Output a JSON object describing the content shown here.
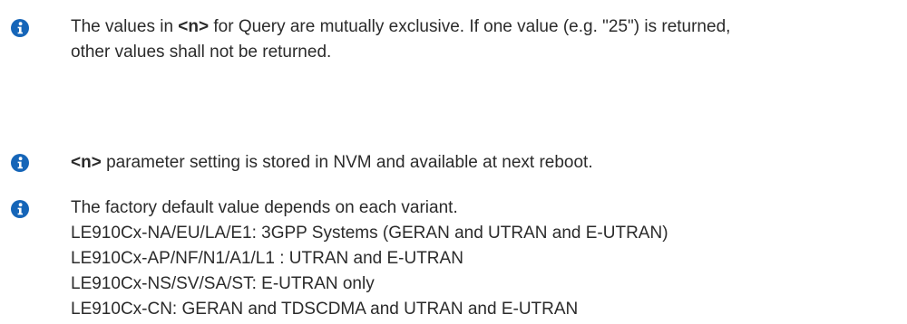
{
  "notes": [
    {
      "icon": "info-icon",
      "lines": [
        {
          "prefix": "The values in ",
          "bold": "<n>",
          "suffix": " for Query are mutually exclusive. If one value (e.g. \"25\") is returned,"
        },
        {
          "text": "other values shall not be returned."
        }
      ]
    },
    {
      "icon": "info-icon",
      "lines": [
        {
          "bold": "<n>",
          "suffix": " parameter setting is stored in NVM and available at next reboot."
        }
      ]
    },
    {
      "icon": "info-icon",
      "lines": [
        {
          "text": "The factory default value depends on each variant."
        },
        {
          "text": "LE910Cx-NA/EU/LA/E1: 3GPP Systems (GERAN and UTRAN and E-UTRAN)"
        },
        {
          "text": "LE910Cx-AP/NF/N1/A1/L1 : UTRAN and E-UTRAN"
        },
        {
          "text": "LE910Cx-NS/SV/SA/ST: E-UTRAN only"
        },
        {
          "text": "LE910Cx-CN: GERAN and TDSCDMA and UTRAN and E-UTRAN"
        }
      ]
    }
  ],
  "colors": {
    "icon_fill": "#1565b8",
    "text": "#2b2b2b"
  }
}
